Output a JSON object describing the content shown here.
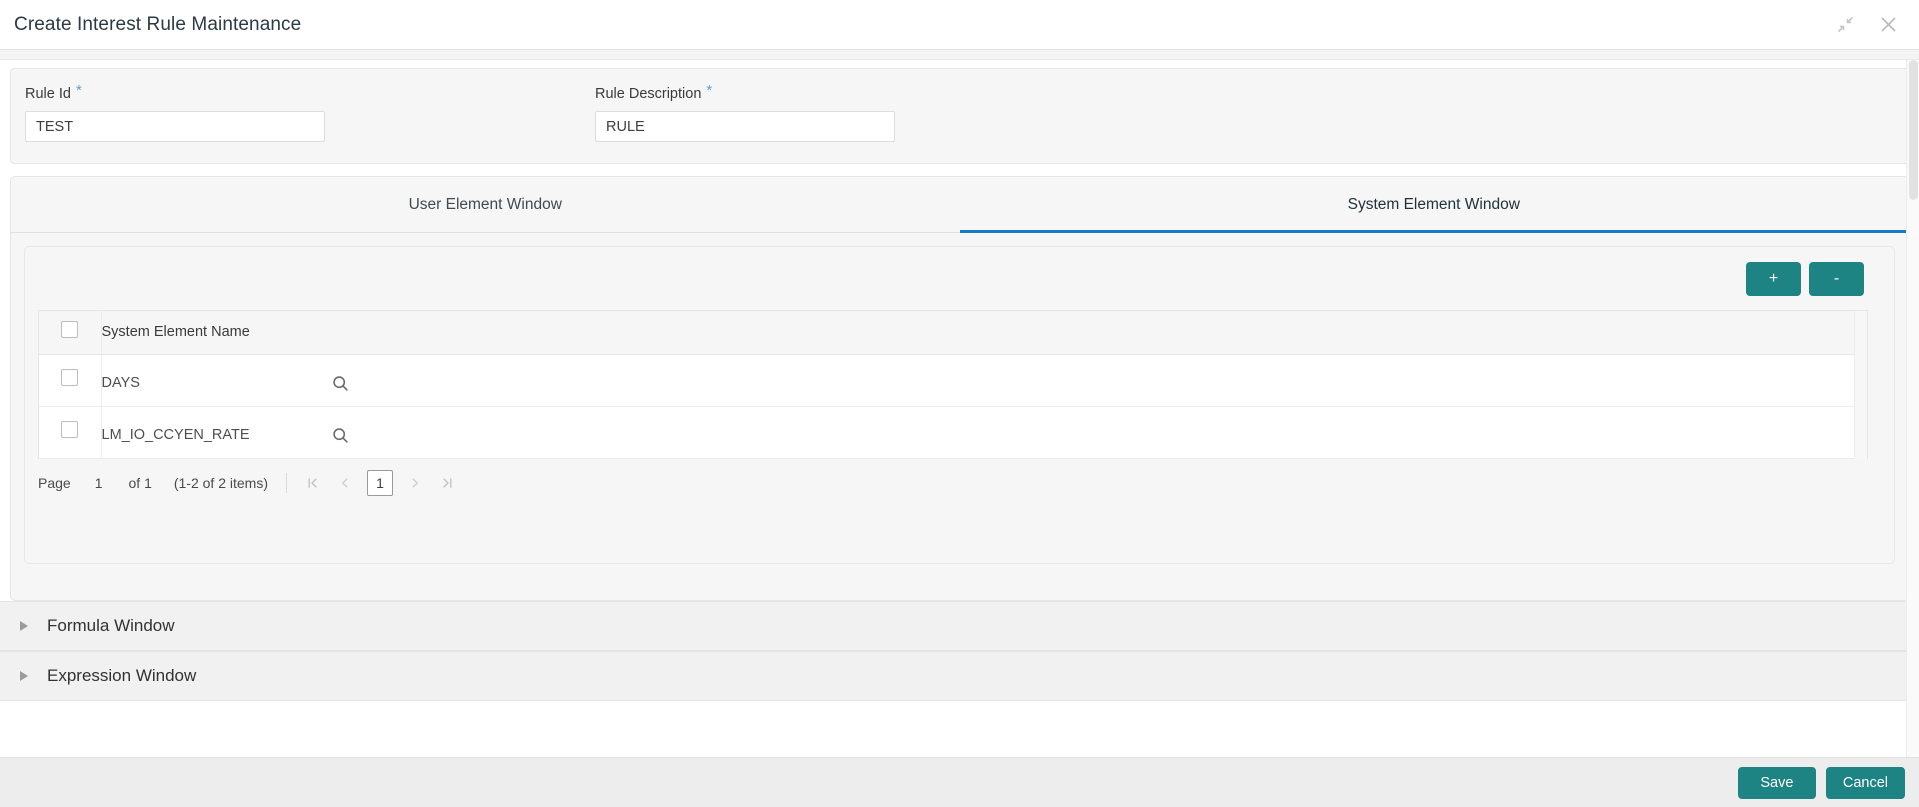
{
  "window": {
    "title": "Create Interest Rule Maintenance",
    "minimize_icon": "collapse-arrows-icon",
    "close_icon": "close-icon"
  },
  "header_fields": [
    {
      "label": "Rule Id",
      "required_marker": "*",
      "value": "TEST",
      "placeholder": ""
    },
    {
      "label": "Rule Description",
      "required_marker": "*",
      "value": "RULE",
      "placeholder": ""
    }
  ],
  "tabs": [
    {
      "label": "User Element Window",
      "active": false
    },
    {
      "label": "System Element Window",
      "active": true
    }
  ],
  "grid_toolbar": {
    "add_label": "+",
    "remove_label": "-"
  },
  "grid": {
    "columns": [
      "System Element Name"
    ],
    "rows": [
      {
        "name": "DAYS",
        "search_icon": "search-icon",
        "checked": false
      },
      {
        "name": "LM_IO_CCYEN_RATE",
        "search_icon": "search-icon",
        "checked": false
      }
    ],
    "select_all_checked": false
  },
  "pagination": {
    "page_label": "Page",
    "page_value": "1",
    "of_label": "of 1",
    "items_label": "(1-2 of 2 items)",
    "first_icon": "❘‹",
    "prev_icon": "‹",
    "current_page": "1",
    "next_icon": "›",
    "last_icon": "›❘"
  },
  "accordions": [
    {
      "label": "Formula Window",
      "expanded": false,
      "caret": "caret-right-icon"
    },
    {
      "label": "Expression Window",
      "expanded": false,
      "caret": "caret-right-icon"
    }
  ],
  "footer": {
    "save_label": "Save",
    "cancel_label": "Cancel"
  },
  "colors": {
    "accent_teal": "#1d8383",
    "tab_active_blue": "#1a7ac0",
    "required_blue": "#5f9ed1",
    "panel_bg": "#f6f6f6",
    "footer_bg": "#ededed"
  }
}
